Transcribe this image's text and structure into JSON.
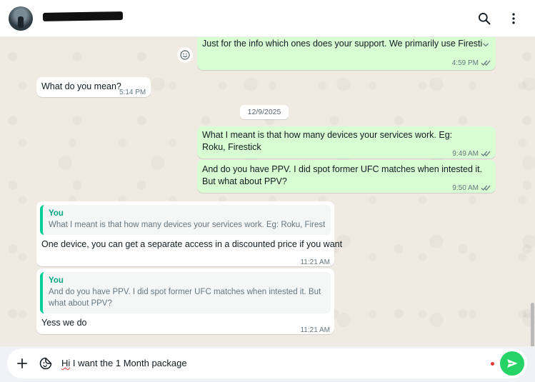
{
  "header": {
    "contact_name": "",
    "search_icon": "search-icon",
    "menu_icon": "more-vertical-icon"
  },
  "messages": [
    {
      "dir": "out",
      "text": "Just for the info which ones does your support. We primarily use Firestic",
      "time": "4:59 PM",
      "status": "read",
      "reaction_button": "smiley-icon"
    },
    {
      "dir": "in",
      "text": "What do you mean?",
      "time": "5:14 PM"
    },
    {
      "dir": "out",
      "text": "What I meant is that how many devices your services work. Eg: Roku, Firestick",
      "time": "9:49 AM",
      "status": "read"
    },
    {
      "dir": "out",
      "text": "And do you have PPV. I did spot former UFC matches when intested it. But what about PPV?",
      "time": "9:50 AM",
      "status": "read"
    },
    {
      "dir": "in",
      "quote_author": "You",
      "quote_text": "What I meant is that how many devices your services work. Eg: Roku, Firestick",
      "text": "One device, you can get a separate access in a discounted price if you want",
      "time": "11:21 AM"
    },
    {
      "dir": "in",
      "quote_author": "You",
      "quote_text": "And do you have PPV. I did spot former UFC matches when intested it. But what about PPV?",
      "text": "Yess we do",
      "time": "11:21 AM"
    }
  ],
  "date_divider": "12/9/2025",
  "composer": {
    "text": "Hi I want the 1 Month package",
    "text_first_word": "Hi",
    "text_rest": " I want the 1 Month package",
    "attach_icon": "plus-icon",
    "sticker_icon": "sticker-icon",
    "send_icon": "send-icon"
  },
  "colors": {
    "outgoing_bubble": "#d9fdd3",
    "incoming_bubble": "#ffffff",
    "chat_background": "#efeae2",
    "accent": "#25d366",
    "read_ticks": "#53bdeb"
  }
}
